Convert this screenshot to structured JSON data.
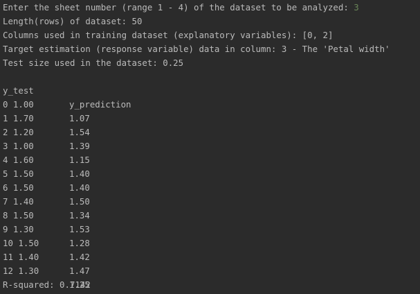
{
  "console": {
    "prompt_text": "Enter the sheet number (range 1 - 4) of the dataset to be analyzed: ",
    "prompt_input": "3",
    "length_line": "Length(rows) of dataset: 50",
    "columns_line": "Columns used in training dataset (explanatory variables): [0, 2]",
    "target_line": "Target estimation (response variable) data in column: 3 - The 'Petal width'",
    "test_size_line": "Test size used in the dataset: 0.25",
    "table": {
      "headers": [
        "y_test",
        "y_prediction"
      ],
      "rows": [
        [
          "0 1.00",
          "1.07"
        ],
        [
          "1 1.70",
          "1.54"
        ],
        [
          "2 1.20",
          "1.39"
        ],
        [
          "3 1.00",
          "1.15"
        ],
        [
          "4 1.60",
          "1.40"
        ],
        [
          "5 1.50",
          "1.40"
        ],
        [
          "6 1.50",
          "1.50"
        ],
        [
          "7 1.40",
          "1.34"
        ],
        [
          "8 1.50",
          "1.53"
        ],
        [
          "9 1.30",
          "1.28"
        ],
        [
          "10 1.50",
          "1.42"
        ],
        [
          "11 1.40",
          "1.47"
        ],
        [
          "12 1.30",
          "1.25"
        ]
      ]
    },
    "r_squared_line": "R-squared: 0.7142"
  },
  "colors": {
    "background": "#2b2b2b",
    "text": "#bbbbbb",
    "user_input": "#6a8759"
  }
}
